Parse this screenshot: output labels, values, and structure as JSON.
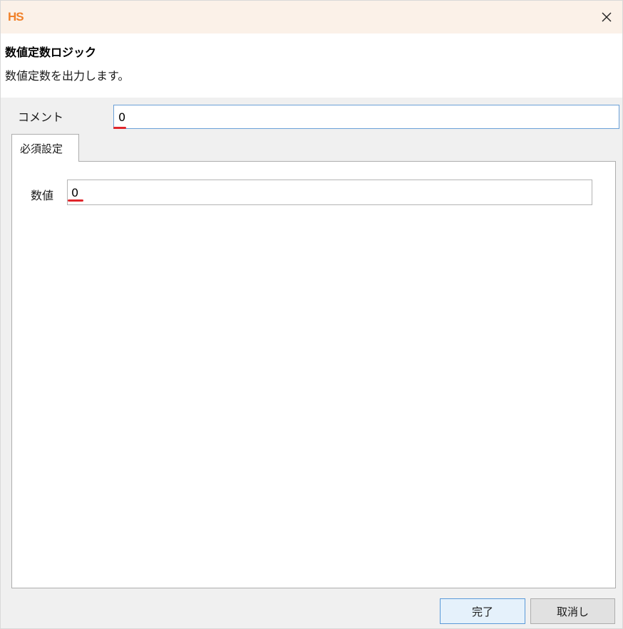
{
  "window": {
    "logo": "HS",
    "close_glyph": "×"
  },
  "header": {
    "title": "数値定数ロジック",
    "description": "数値定数を出力します。"
  },
  "comment": {
    "label": "コメント",
    "value": "0"
  },
  "tabs": [
    {
      "label": "必須設定",
      "selected": true
    }
  ],
  "required_settings": {
    "value_label": "数値",
    "value": "0"
  },
  "buttons": {
    "finish_label": "完了",
    "cancel_label": "取消し"
  },
  "icons": {
    "close": "close-icon"
  },
  "colors": {
    "titlebar_bg": "#fbf1e8",
    "logo": "#f0812a",
    "error_underline": "#e0262b",
    "focus_border": "#6aa0d8"
  }
}
